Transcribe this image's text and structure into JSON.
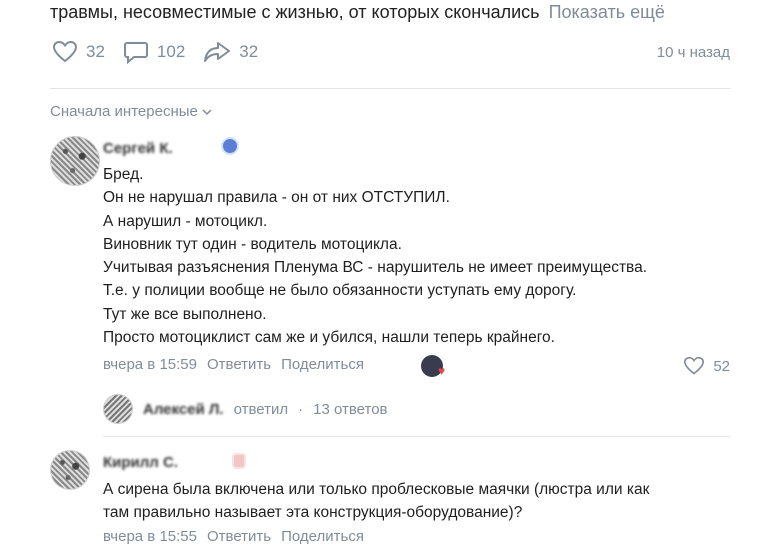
{
  "post": {
    "text_visible": "травмы, несовместимые с жизнью, от которых скончались",
    "show_more": "Показать ещё",
    "likes": "32",
    "comments": "102",
    "shares": "32",
    "time": "10 ч назад"
  },
  "sort_label": "Сначала интересные",
  "comments": [
    {
      "author": "Сергей К.",
      "lines": [
        "Бред.",
        "Он не нарушал правила - он от них ОТСТУПИЛ.",
        "А нарушил - мотоцикл.",
        "Виновник тут один - водитель мотоцикла.",
        "Учитывая разъяснения Пленума ВС - нарушитель не имеет преимущества.",
        "Т.е. у полиции вообще не было обязанности уступать ему дорогу.",
        "Тут же все выполнено.",
        "Просто мотоциклист сам же и убился, нашли теперь крайнего."
      ],
      "time": "вчера в 15:59",
      "reply": "Ответить",
      "share": "Поделиться",
      "likes": "52"
    },
    {
      "author": "Кирилл С.",
      "lines": [
        "А сирена была включена или только проблесковые маячки (люстра или как",
        "там правильно называет эта конструкция-оборудование)?"
      ],
      "time": "вчера в 15:55",
      "reply": "Ответить",
      "share": "Поделиться"
    }
  ],
  "thread": {
    "author": "Алексей Л.",
    "replied": "ответил",
    "count": "13 ответов"
  },
  "colors": {
    "muted": "#818c99",
    "text": "#1f1f1f",
    "heart": "#e64646"
  }
}
